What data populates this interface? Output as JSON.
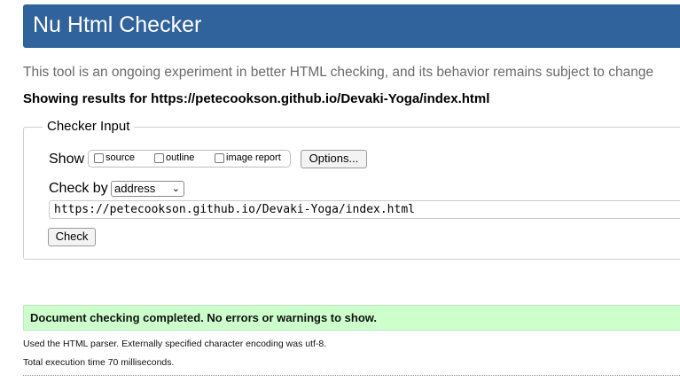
{
  "header": {
    "title": "Nu Html Checker",
    "color": "#30629b"
  },
  "tagline": "This tool is an ongoing experiment in better HTML checking, and its behavior remains subject to change",
  "results_for": "Showing results for https://petecookson.github.io/Devaki-Yoga/index.html",
  "checker_input": {
    "legend": "Checker Input",
    "show_label": "Show",
    "show_options": [
      {
        "label": "source",
        "checked": false
      },
      {
        "label": "outline",
        "checked": false
      },
      {
        "label": "image report",
        "checked": false
      }
    ],
    "options_button": "Options...",
    "check_by_label": "Check by",
    "check_by_value": "address",
    "url_value": "https://petecookson.github.io/Devaki-Yoga/index.html",
    "check_button": "Check"
  },
  "result": {
    "message": "Document checking completed. No errors or warnings to show.",
    "color": "#ccffcc"
  },
  "notes": {
    "parser": "Used the HTML parser. Externally specified character encoding was utf-8.",
    "time": "Total execution time 70 milliseconds."
  }
}
